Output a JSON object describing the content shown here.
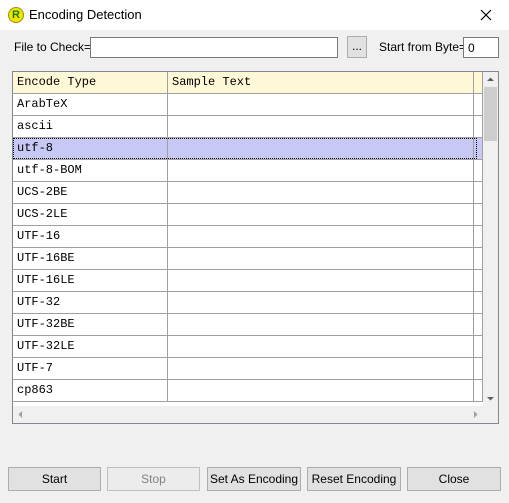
{
  "window": {
    "title": "Encoding Detection",
    "app_icon_letter": "R"
  },
  "form": {
    "file_label": "File to Check=>",
    "file_value": "",
    "browse_label": "...",
    "start_byte_label": "Start from Byte=>",
    "start_byte_value": "0"
  },
  "table": {
    "columns": [
      "Encode Type",
      "Sample Text"
    ],
    "selected_index": 2,
    "rows": [
      {
        "type": "ArabTeX",
        "sample": ""
      },
      {
        "type": "ascii",
        "sample": ""
      },
      {
        "type": "utf-8",
        "sample": ""
      },
      {
        "type": "utf-8-BOM",
        "sample": ""
      },
      {
        "type": "UCS-2BE",
        "sample": ""
      },
      {
        "type": "UCS-2LE",
        "sample": ""
      },
      {
        "type": "UTF-16",
        "sample": ""
      },
      {
        "type": "UTF-16BE",
        "sample": ""
      },
      {
        "type": "UTF-16LE",
        "sample": ""
      },
      {
        "type": "UTF-32",
        "sample": ""
      },
      {
        "type": "UTF-32BE",
        "sample": ""
      },
      {
        "type": "UTF-32LE",
        "sample": ""
      },
      {
        "type": "UTF-7",
        "sample": ""
      },
      {
        "type": "cp863",
        "sample": ""
      }
    ]
  },
  "buttons": {
    "start": "Start",
    "stop": "Stop",
    "set_as_encoding": "Set As Encoding",
    "reset_encoding": "Reset Encoding",
    "close": "Close"
  },
  "colors": {
    "header_bg": "#fff8d6",
    "selection_bg": "#c8c8f5"
  }
}
